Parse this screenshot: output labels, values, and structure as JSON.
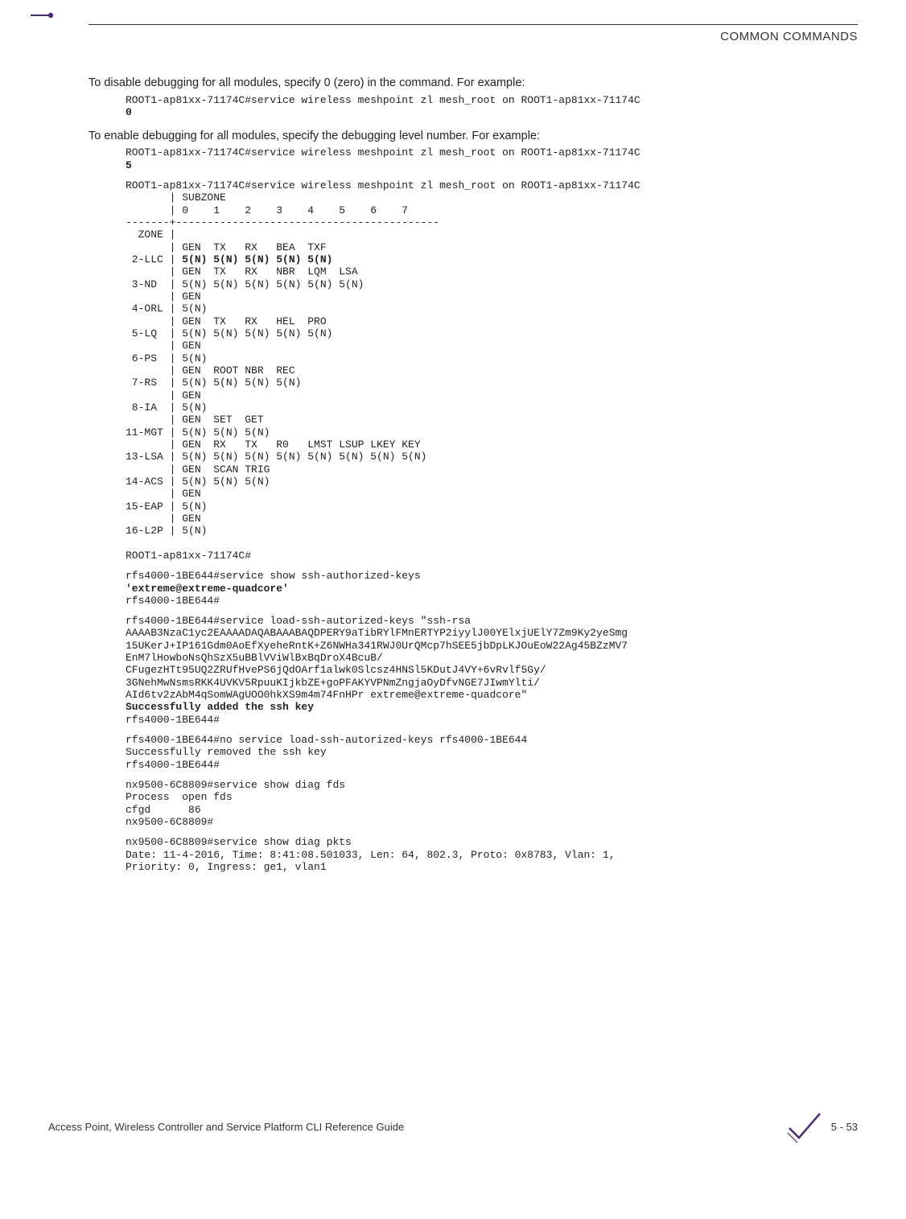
{
  "header": {
    "title": "COMMON COMMANDS"
  },
  "para1": "To disable debugging for all modules, specify 0 (zero) in the command. For example:",
  "cmd1_line": "ROOT1-ap81xx-71174C#service wireless meshpoint zl mesh_root on ROOT1-ap81xx-71174C ",
  "cmd1_bold": "0",
  "para2": "To enable debugging for all modules, specify the debugging level number. For example:",
  "cmd2_line": "ROOT1-ap81xx-71174C#service wireless meshpoint zl mesh_root on ROOT1-ap81xx-71174C ",
  "cmd2_bold": "5",
  "table_head": "ROOT1-ap81xx-71174C#service wireless meshpoint zl mesh_root on ROOT1-ap81xx-71174C",
  "table_rows": {
    "r01": "       | SUBZONE",
    "r02": "       | 0    1    2    3    4    5    6    7",
    "r03": "-------+------------------------------------------",
    "r04": "  ZONE |",
    "r05": "       | GEN  TX   RX   BEA  TXF",
    "r06a": " 2-LLC | ",
    "r06b": "5(N) 5(N) 5(N) 5(N) 5(N)",
    "r07": "       | GEN  TX   RX   NBR  LQM  LSA",
    "r08": " 3-ND  | 5(N) 5(N) 5(N) 5(N) 5(N) 5(N)",
    "r09": "       | GEN",
    "r10": " 4-ORL | 5(N)",
    "r11": "       | GEN  TX   RX   HEL  PRO",
    "r12": " 5-LQ  | 5(N) 5(N) 5(N) 5(N) 5(N)",
    "r13": "       | GEN",
    "r14": " 6-PS  | 5(N)",
    "r15": "       | GEN  ROOT NBR  REC",
    "r16": " 7-RS  | 5(N) 5(N) 5(N) 5(N)",
    "r17": "       | GEN",
    "r18": " 8-IA  | 5(N)",
    "r19": "       | GEN  SET  GET",
    "r20": "11-MGT | 5(N) 5(N) 5(N)",
    "r21": "       | GEN  RX   TX   R0   LMST LSUP LKEY KEY",
    "r22": "13-LSA | 5(N) 5(N) 5(N) 5(N) 5(N) 5(N) 5(N) 5(N)",
    "r23": "       | GEN  SCAN TRIG",
    "r24": "14-ACS | 5(N) 5(N) 5(N)",
    "r25": "       | GEN",
    "r26": "15-EAP | 5(N)",
    "r27": "       | GEN",
    "r28": "16-L2P | 5(N)",
    "r29": "",
    "r30": "ROOT1-ap81xx-71174C#"
  },
  "block2": {
    "l1": "rfs4000-1BE644#service show ssh-authorized-keys",
    "l2_bold": "'extreme@extreme-quadcore'",
    "l3": "rfs4000-1BE644#"
  },
  "block3": {
    "l1": "rfs4000-1BE644#service load-ssh-autorized-keys \"ssh-rsa ",
    "l2": "AAAAB3NzaC1yc2EAAAADAQABAAABAQDPERY9aTibRYlFMnERTYP2iyylJ00YElxjUElY7Zm9Ky2yeSmg",
    "l3": "15UKerJ+IP161Gdm0AoEfXyeheRntK+Z6NWHa341RWJ0UrQMcp7hSEE5jbDpLKJOuEoW22Ag45BZzMV7",
    "l4": "EnM7lHowboNsQhSzX5uBBlVViWlBxBqDroX4BcuB/",
    "l5": "CFugezHTt95UQ2ZRUfHvePS6jQdOArf1alwk0Slcsz4HNSl5KDutJ4VY+6vRvlf5Gy/",
    "l6": "3GNehMwNsmsRKK4UVKV5RpuuKIjkbZE+goPFAKYVPNmZngjaOyDfvNGE7JIwmYlti/",
    "l7": "AId6tv2zAbM4qSomWAgUOO0hkXS9m4m74FnHPr extreme@extreme-quadcore\"",
    "l8_bold": "Successfully added the ssh key",
    "l9": "rfs4000-1BE644#"
  },
  "block4": {
    "l1": "rfs4000-1BE644#no service load-ssh-autorized-keys rfs4000-1BE644",
    "l2": "Successfully removed the ssh key",
    "l3": "rfs4000-1BE644#"
  },
  "block5": {
    "l1": "nx9500-6C8809#service show diag fds",
    "l2": "Process  open fds",
    "l3": "cfgd      86",
    "l4": "nx9500-6C8809#"
  },
  "block6": {
    "l1": "nx9500-6C8809#service show diag pkts",
    "l2": "Date: 11-4-2016, Time: 8:41:08.501033, Len: 64, 802.3, Proto: 0x8783, Vlan: 1, ",
    "l3": "Priority: 0, Ingress: ge1, vlan1"
  },
  "footer": {
    "left": "Access Point, Wireless Controller and Service Platform CLI Reference Guide",
    "page": "5 - 53"
  }
}
